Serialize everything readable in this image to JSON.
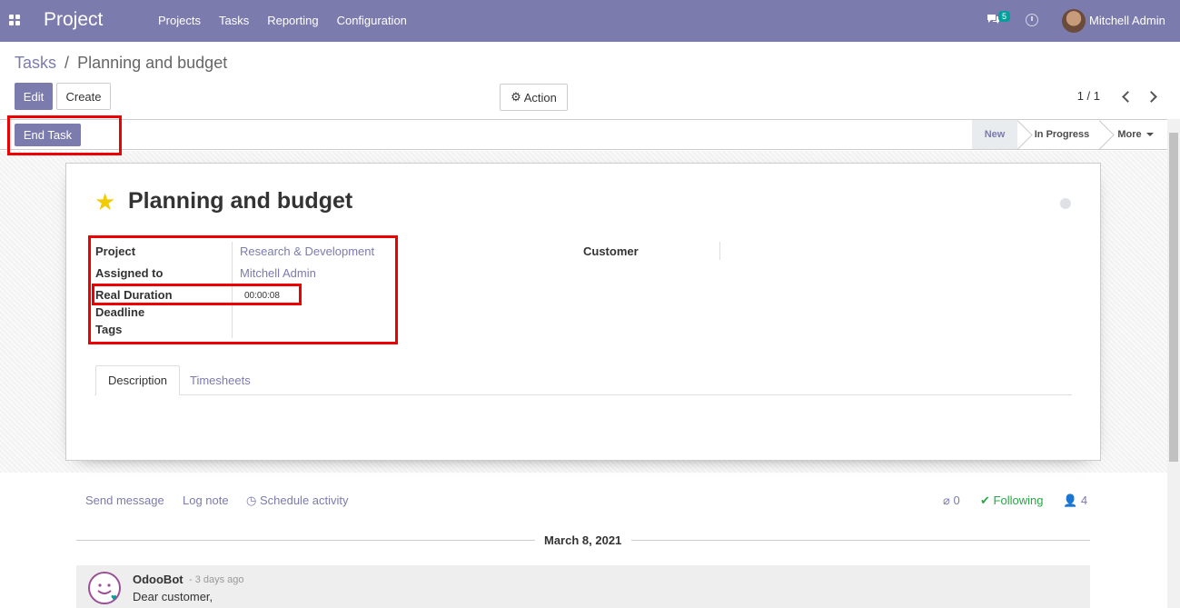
{
  "navbar": {
    "brand": "Project",
    "menu": [
      "Projects",
      "Tasks",
      "Reporting",
      "Configuration"
    ],
    "chat_count": "5",
    "user_name": "Mitchell Admin"
  },
  "breadcrumb": {
    "parent": "Tasks",
    "separator": "/",
    "current": "Planning and budget"
  },
  "controls": {
    "edit_label": "Edit",
    "create_label": "Create",
    "action_label": "Action",
    "pager": "1 / 1"
  },
  "statusbar": {
    "button_label": "End Task",
    "stages": [
      "New",
      "In Progress"
    ],
    "active_stage": "New",
    "more_label": "More"
  },
  "task": {
    "title": "Planning and budget",
    "fields": {
      "project_label": "Project",
      "project_value": "Research & Development",
      "assigned_label": "Assigned to",
      "assigned_value": "Mitchell Admin",
      "duration_label": "Real Duration",
      "duration_value": "00:00:08",
      "deadline_label": "Deadline",
      "tags_label": "Tags",
      "customer_label": "Customer"
    },
    "tabs": [
      "Description",
      "Timesheets"
    ]
  },
  "chatter": {
    "send_message": "Send message",
    "log_note": "Log note",
    "schedule_activity": "Schedule activity",
    "attachments": "0",
    "following": "Following",
    "followers": "4",
    "date": "March 8, 2021",
    "message": {
      "author": "OdooBot",
      "time": "- 3 days ago",
      "body": "Dear customer,"
    }
  },
  "colors": {
    "brand": "#7c7bad",
    "highlight": "#ee0000",
    "star": "#f3cc00"
  }
}
